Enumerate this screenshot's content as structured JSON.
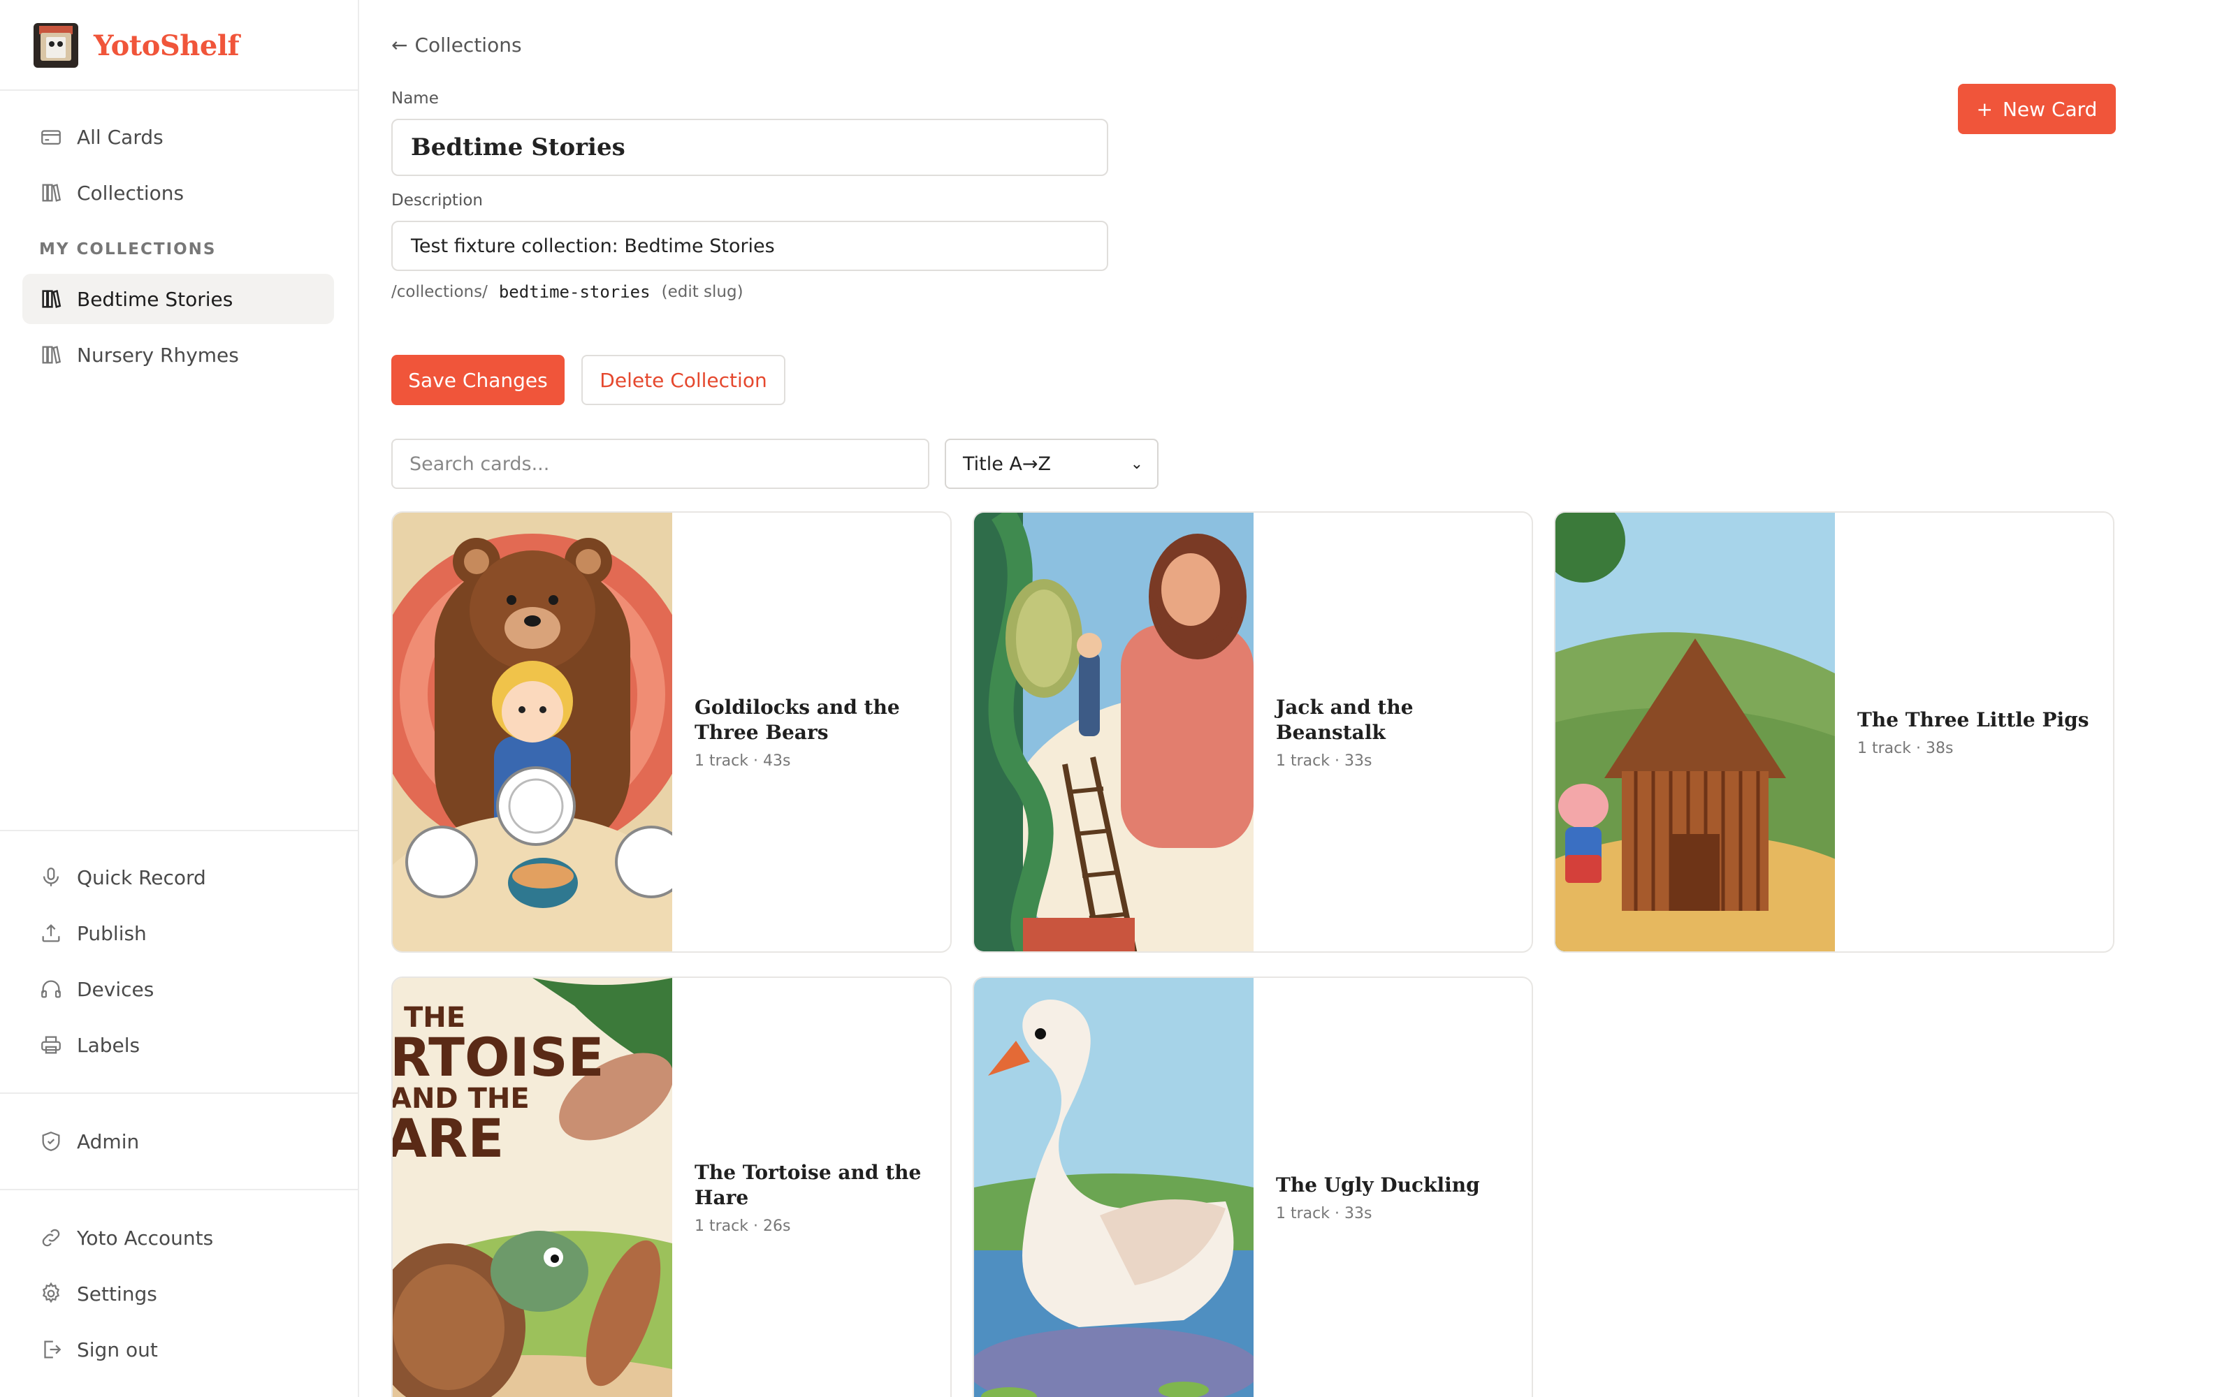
{
  "app": {
    "name": "YotoShelf"
  },
  "sidebar": {
    "top_items": [
      {
        "label": "All Cards",
        "icon": "card-icon"
      },
      {
        "label": "Collections",
        "icon": "books-icon"
      }
    ],
    "section_label": "MY COLLECTIONS",
    "collections": [
      {
        "label": "Bedtime Stories",
        "icon": "books-icon",
        "active": true
      },
      {
        "label": "Nursery Rhymes",
        "icon": "books-icon",
        "active": false
      }
    ],
    "tools": [
      {
        "label": "Quick Record",
        "icon": "microphone-icon"
      },
      {
        "label": "Publish",
        "icon": "upload-icon"
      },
      {
        "label": "Devices",
        "icon": "headphones-icon"
      },
      {
        "label": "Labels",
        "icon": "printer-icon"
      }
    ],
    "admin": {
      "label": "Admin",
      "icon": "shield-icon"
    },
    "account": [
      {
        "label": "Yoto Accounts",
        "icon": "link-icon"
      },
      {
        "label": "Settings",
        "icon": "gear-icon"
      },
      {
        "label": "Sign out",
        "icon": "sign-out-icon"
      }
    ]
  },
  "main": {
    "back_link": "Collections",
    "name_label": "Name",
    "name_value": "Bedtime Stories",
    "description_label": "Description",
    "description_value": "Test fixture collection: Bedtime Stories",
    "slug_prefix": "/collections/",
    "slug": "bedtime-stories",
    "slug_edit": "(edit slug)",
    "save_button": "Save Changes",
    "delete_button": "Delete Collection",
    "new_card_button": "New Card",
    "search_placeholder": "Search cards...",
    "sort_value": "Title A→Z",
    "accent_color": "#f0553a",
    "cards": [
      {
        "title": "Goldilocks and the Three Bears",
        "meta": "1 track · 43s"
      },
      {
        "title": "Jack and the Beanstalk",
        "meta": "1 track · 33s"
      },
      {
        "title": "The Three Little Pigs",
        "meta": "1 track · 38s"
      },
      {
        "title": "The Tortoise and the Hare",
        "meta": "1 track · 26s",
        "cover_text": [
          "THE",
          "RTOISE",
          "AND THE",
          "ARE"
        ]
      },
      {
        "title": "The Ugly Duckling",
        "meta": "1 track · 33s"
      }
    ]
  }
}
